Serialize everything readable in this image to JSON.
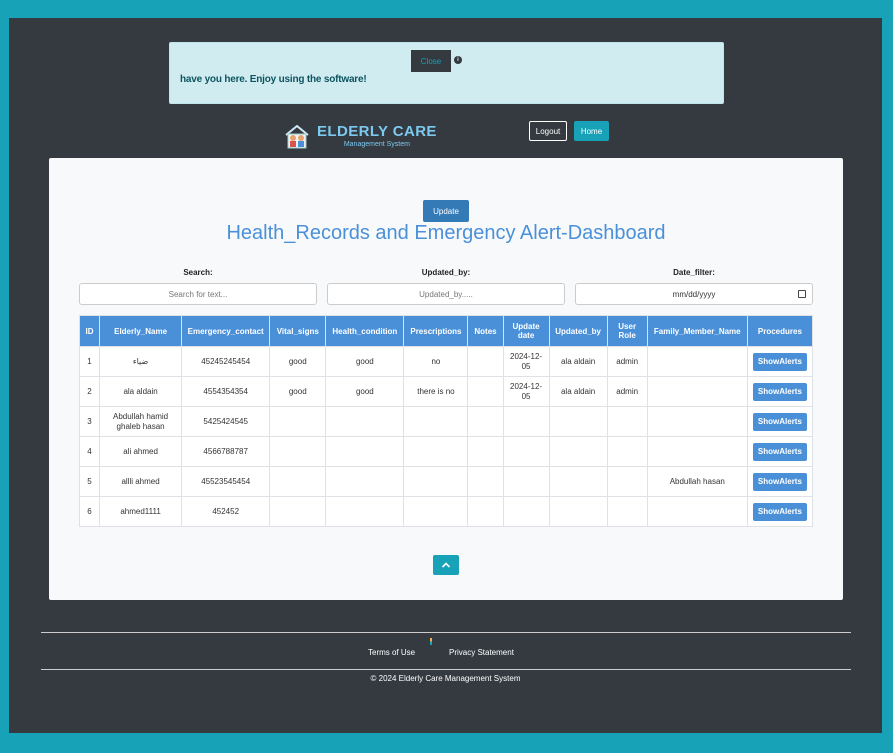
{
  "alert": {
    "close_label": "Close",
    "info_icon": "info-icon",
    "message": "have you here. Enjoy using the software!"
  },
  "header": {
    "brand_title": "ELDERLY CARE",
    "brand_subtitle": "Management System",
    "logout_label": "Logout",
    "home_label": "Home"
  },
  "main": {
    "update_label": "Update",
    "title": "Health_Records and Emergency Alert-Dashboard",
    "filters": {
      "search_label": "Search:",
      "search_placeholder": "Search for text...",
      "updated_by_label": "Updated_by:",
      "updated_by_placeholder": "Updated_by.....",
      "date_label": "Date_filter:",
      "date_placeholder": "mm/dd/yyyy"
    },
    "table": {
      "headers": [
        "ID",
        "Elderly_Name",
        "Emergency_contact",
        "Vital_signs",
        "Health_condition",
        "Prescriptions",
        "Notes",
        "Update date",
        "Updated_by",
        "User Role",
        "Family_Member_Name",
        "Procedures"
      ],
      "action_label": "ShowAlerts",
      "rows": [
        [
          "1",
          "ضياء",
          "45245245454",
          "good",
          "good",
          "no",
          "",
          "2024-12-05",
          "ala aldain",
          "admin",
          ""
        ],
        [
          "2",
          "ala aldain",
          "4554354354",
          "good",
          "good",
          "there is no",
          "",
          "2024-12-05",
          "ala aldain",
          "admin",
          ""
        ],
        [
          "3",
          "Abdullah hamid ghaleb hasan",
          "5425424545",
          "",
          "",
          "",
          "",
          "",
          "",
          "",
          ""
        ],
        [
          "4",
          "ali ahmed",
          "4566788787",
          "",
          "",
          "",
          "",
          "",
          "",
          "",
          ""
        ],
        [
          "5",
          "allli ahmed",
          "45523545454",
          "",
          "",
          "",
          "",
          "",
          "",
          "",
          "Abdullah hasan"
        ],
        [
          "6",
          "ahmed1111",
          "452452",
          "",
          "",
          "",
          "",
          "",
          "",
          "",
          ""
        ]
      ]
    }
  },
  "footer": {
    "terms_label": "Terms of Use",
    "privacy_label": "Privacy Statement",
    "copyright": "© 2024 Elderly Care Management System"
  },
  "colors": {
    "page_border": "#17a2b8",
    "background": "#343a40",
    "accent_blue": "#4a90d9",
    "alert_bg": "#d1ecf1"
  }
}
